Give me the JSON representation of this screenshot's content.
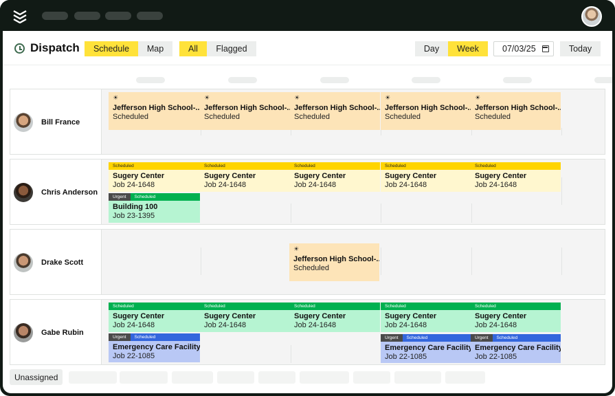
{
  "window": {
    "avatar": "user-avatar-icon"
  },
  "header": {
    "title": "Dispatch",
    "view_tabs": [
      "Schedule",
      "Map"
    ],
    "active_view": "Schedule",
    "filter_tabs": [
      "All",
      "Flagged"
    ],
    "active_filter": "All",
    "range_tabs": [
      "Day",
      "Week"
    ],
    "active_range": "Week",
    "date_value": "07/03/25",
    "today_label": "Today"
  },
  "colors": {
    "accent": "#ffe23a",
    "scheduled_yellow": "#ffd400",
    "scheduled_green": "#00b050",
    "scheduled_blue": "#3366dd",
    "urgent": "#4a4a4a",
    "card_orange": "#fde4b8",
    "card_lightyellow": "#fff7cf",
    "card_mint": "#b6f4d2",
    "card_blue": "#b9c8f5"
  },
  "rows": [
    {
      "name": "Bill France",
      "cards": [
        {
          "style": "orange",
          "sun": true,
          "title": "Jefferson High School-...",
          "subtitle": "Scheduled"
        },
        {
          "style": "orange",
          "sun": true,
          "title": "Jefferson High School-...",
          "subtitle": "Scheduled"
        },
        {
          "style": "orange",
          "sun": true,
          "title": "Jefferson High School-...",
          "subtitle": "Scheduled"
        },
        {
          "style": "orange",
          "sun": true,
          "title": "Jefferson High School-...",
          "subtitle": "Scheduled"
        },
        {
          "style": "orange",
          "sun": true,
          "title": "Jefferson High School-...",
          "subtitle": "Scheduled"
        }
      ]
    },
    {
      "name": "Chris Anderson",
      "cards": [
        {
          "style": "lightyellow",
          "status": "Scheduled",
          "title": "Sugery Center",
          "subtitle": "Job 24-1648"
        },
        {
          "style": "lightyellow",
          "status": "Scheduled",
          "title": "Sugery Center",
          "subtitle": "Job 24-1648"
        },
        {
          "style": "lightyellow",
          "status": "Scheduled",
          "title": "Sugery Center",
          "subtitle": "Job 24-1648"
        },
        {
          "style": "lightyellow",
          "status": "Scheduled",
          "title": "Sugery Center",
          "subtitle": "Job 24-1648"
        },
        {
          "style": "lightyellow",
          "status": "Scheduled",
          "title": "Sugery Center",
          "subtitle": "Job 24-1648"
        },
        {
          "style": "mint",
          "urgent": "Urgent",
          "status": "Scheduled",
          "title": "Building 100",
          "subtitle": "Job 23-1395"
        }
      ]
    },
    {
      "name": "Drake Scott",
      "cards": [
        {
          "style": "orange",
          "sun": true,
          "title": "Jefferson High School-...",
          "subtitle": "Scheduled"
        }
      ]
    },
    {
      "name": "Gabe Rubin",
      "cards": [
        {
          "style": "mint",
          "status": "Scheduled",
          "title": "Sugery Center",
          "subtitle": "Job 24-1648"
        },
        {
          "style": "mint",
          "status": "Scheduled",
          "title": "Sugery Center",
          "subtitle": "Job 24-1648"
        },
        {
          "style": "mint",
          "status": "Scheduled",
          "title": "Sugery Center",
          "subtitle": "Job 24-1648"
        },
        {
          "style": "mint",
          "status": "Scheduled",
          "title": "Sugery Center",
          "subtitle": "Job 24-1648"
        },
        {
          "style": "mint",
          "status": "Scheduled",
          "title": "Sugery Center",
          "subtitle": "Job 24-1648"
        },
        {
          "style": "blue",
          "urgent": "Urgent",
          "status": "Scheduled",
          "title": "Emergency Care Facility",
          "subtitle": "Job 22-1085"
        },
        {
          "style": "blue",
          "urgent": "Urgent",
          "status": "Scheduled",
          "title": "Emergency Care Facility",
          "subtitle": "Job 22-1085"
        },
        {
          "style": "blue",
          "urgent": "Urgent",
          "status": "Scheduled",
          "title": "Emergency Care Facility",
          "subtitle": "Job 22-1085"
        }
      ]
    }
  ],
  "footer": {
    "unassigned_label": "Unassigned"
  }
}
